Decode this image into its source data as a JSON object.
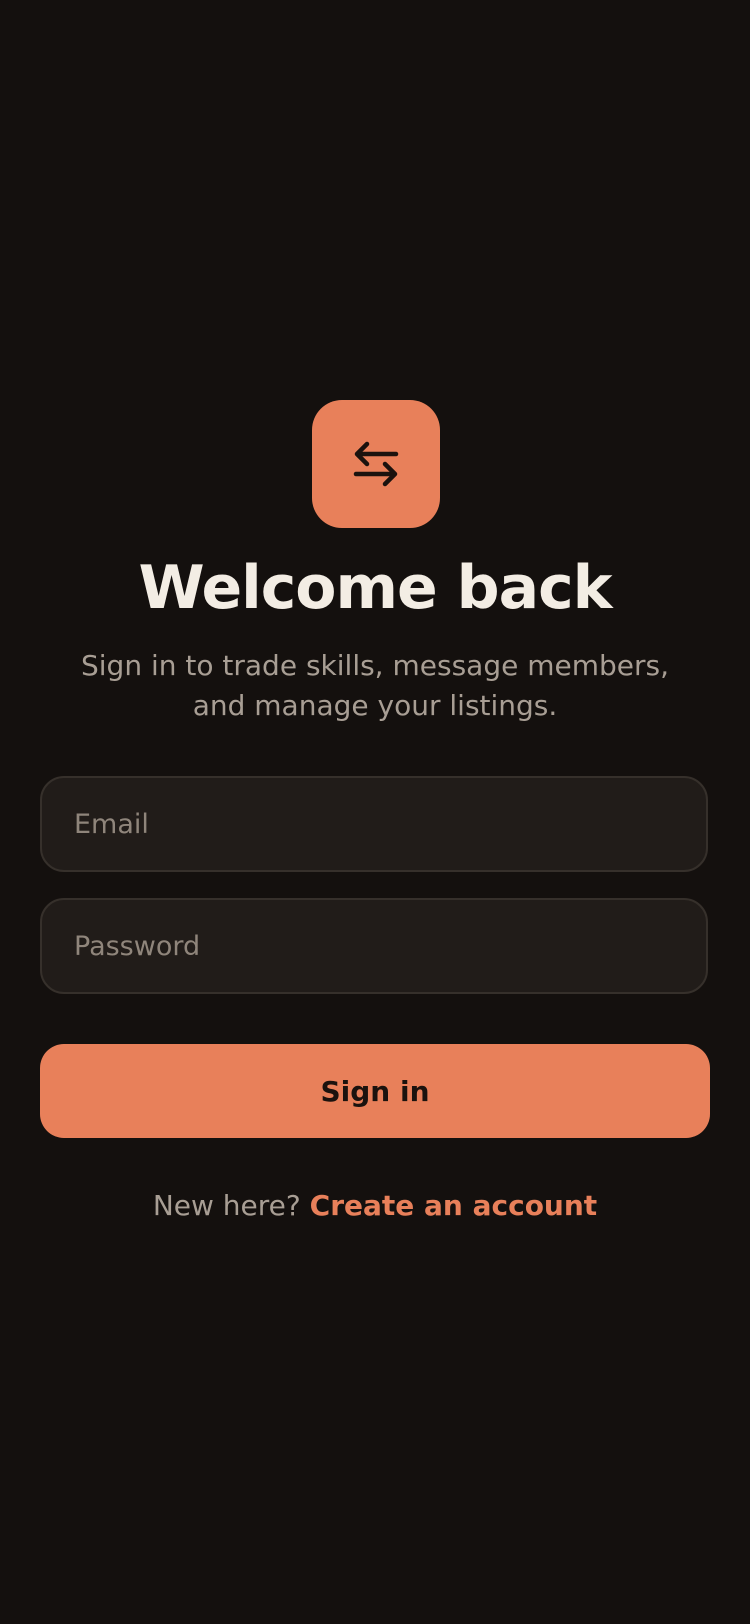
{
  "colors": {
    "background": "#14100e",
    "accent": "#e8805a",
    "input_background": "#211c19",
    "input_border": "#36302b",
    "title_text": "#f3ede4",
    "muted_text": "#a89e94"
  },
  "logo": {
    "icon": "swap-arrows-icon"
  },
  "header": {
    "title": "Welcome back",
    "subtitle": "Sign in to trade skills, message members, and manage your listings."
  },
  "form": {
    "email": {
      "placeholder": "Email",
      "value": ""
    },
    "password": {
      "placeholder": "Password",
      "value": ""
    },
    "submit_label": "Sign in"
  },
  "footer": {
    "prompt": "New here?",
    "link_label": "Create an account"
  }
}
